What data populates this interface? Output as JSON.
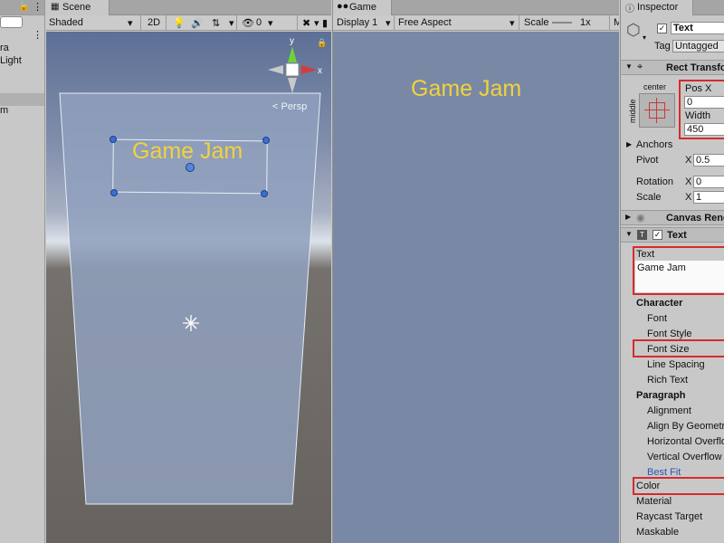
{
  "hierarchy": {
    "items": [
      "ra",
      "Light",
      "m"
    ]
  },
  "scene": {
    "tab_label": "Scene",
    "shading_mode": "Shaded",
    "mode_2d": "2D",
    "hidden_count": "0",
    "persp_label": "< Persp",
    "gizmo_y": "y",
    "gizmo_x": "x",
    "text_content": "Game Jam"
  },
  "game": {
    "tab_label": "Game",
    "display": "Display 1",
    "aspect": "Free Aspect",
    "scale_label": "Scale",
    "scale_value": "1x",
    "text_content": "Game Jam"
  },
  "inspector": {
    "tab_label": "Inspector",
    "object_name": "Text",
    "tag_label": "Tag",
    "tag_value": "Untagged",
    "rect_transform": {
      "title": "Rect Transfo",
      "anchor_h": "center",
      "anchor_v": "middle",
      "posx_label": "Pos X",
      "posx_value": "0",
      "width_label": "Width",
      "width_value": "450",
      "anchors_label": "Anchors",
      "pivot_label": "Pivot",
      "pivot_x_label": "X",
      "pivot_x_value": "0.5",
      "rotation_label": "Rotation",
      "rotation_x_label": "X",
      "rotation_x_value": "0",
      "scale_label": "Scale",
      "scale_x_label": "X",
      "scale_x_value": "1"
    },
    "canvas_renderer": {
      "title": "Canvas Rend"
    },
    "text_component": {
      "title": "Text",
      "text_label": "Text",
      "text_value": "Game Jam",
      "character_label": "Character",
      "font_label": "Font",
      "font_style_label": "Font Style",
      "font_size_label": "Font Size",
      "line_spacing_label": "Line Spacing",
      "rich_text_label": "Rich Text",
      "paragraph_label": "Paragraph",
      "alignment_label": "Alignment",
      "align_by_geometry_label": "Align By Geometry",
      "horizontal_overflow_label": "Horizontal Overflo",
      "vertical_overflow_label": "Vertical Overflow",
      "best_fit_label": "Best Fit",
      "color_label": "Color",
      "material_label": "Material",
      "raycast_target_label": "Raycast Target",
      "maskable_label": "Maskable"
    }
  },
  "colors": {
    "text_yellow": "#f2d23c",
    "highlight_red": "#d62b2b",
    "link_blue": "#2a55b5"
  }
}
